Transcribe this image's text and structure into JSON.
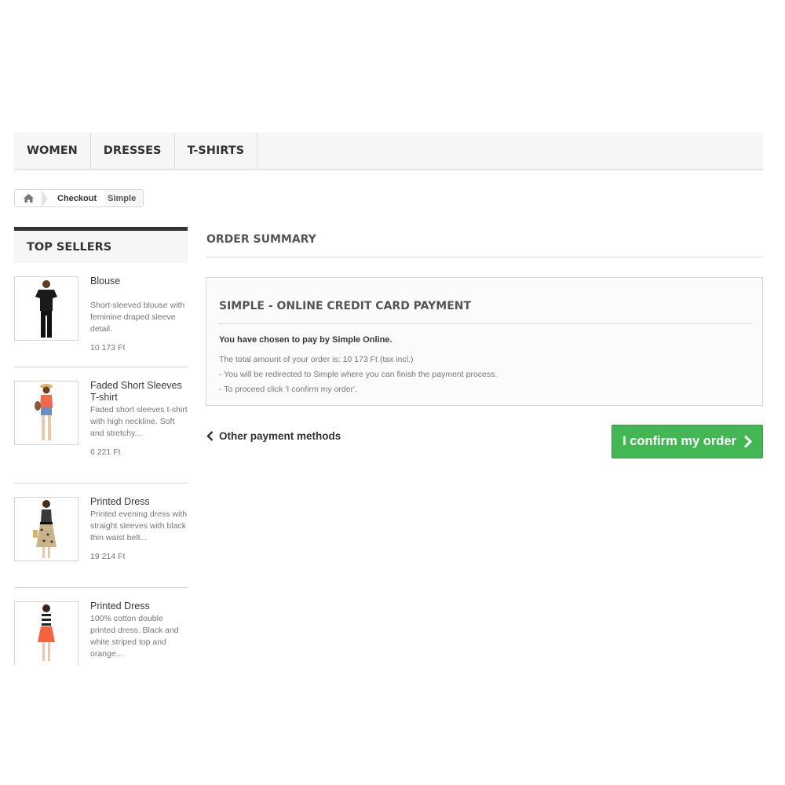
{
  "nav": {
    "items": [
      "WOMEN",
      "DRESSES",
      "T-SHIRTS"
    ]
  },
  "breadcrumb": {
    "home_icon": "home-icon",
    "checkout": "Checkout",
    "current": "Simple"
  },
  "sidebar": {
    "title": "TOP SELLERS",
    "products": [
      {
        "name": "Blouse",
        "description": "Short-sleeved blouse with feminine draped sleeve detail.",
        "price": "10 173 Ft"
      },
      {
        "name": "Faded Short Sleeves T-shirt",
        "description": "Faded short sleeves t-shirt with high neckline. Soft and stretchy...",
        "price": "6 221 Ft"
      },
      {
        "name": "Printed Dress",
        "description": "Printed evening dress with straight sleeves with black thin waist belt...",
        "price": "19 214 Ft"
      },
      {
        "name": "Printed Dress",
        "description": "100% cotton double printed dress. Black and white striped top and orange...",
        "price": ""
      }
    ]
  },
  "main": {
    "title": "ORDER SUMMARY",
    "payment": {
      "title": "SIMPLE - ONLINE CREDIT CARD PAYMENT",
      "chosen": "You have chosen to pay by Simple Online.",
      "total": "The total amount of your order is: 10 173 Ft (tax incl.)",
      "redirect": "- You will be redirected to Simple where you can finish the payment process.",
      "proceed": "- To proceed click 'I confirm my order'."
    },
    "back_label": "Other payment methods",
    "confirm_label": "I confirm my order"
  },
  "colors": {
    "confirm_button": "#43b754",
    "sidebar_title_border": "#333333"
  }
}
